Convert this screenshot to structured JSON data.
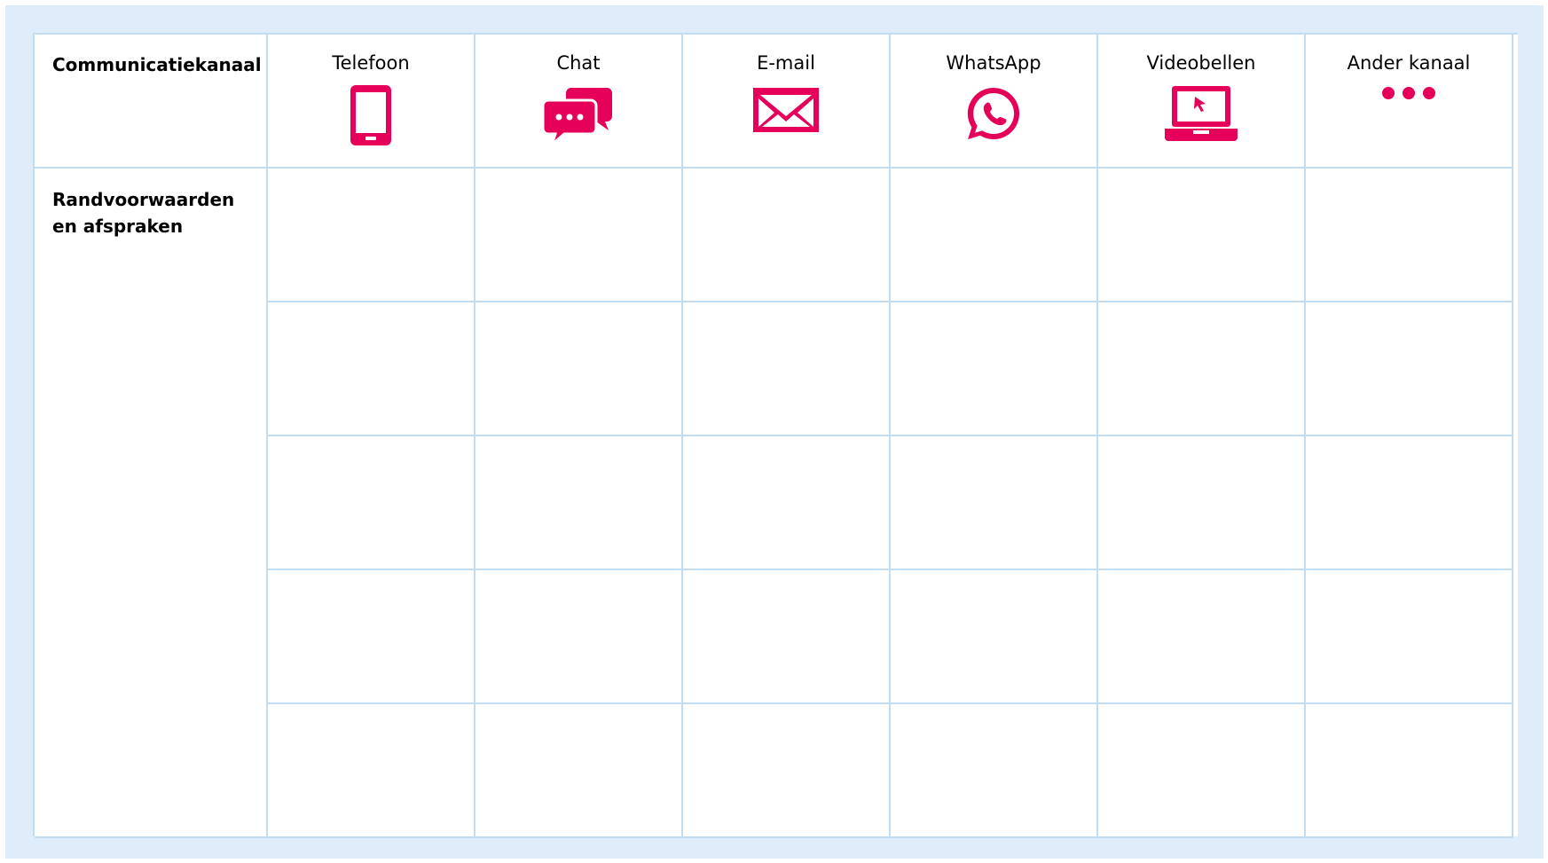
{
  "header": {
    "corner_label": "Communicatiekanaal",
    "channels": [
      {
        "label": "Telefoon",
        "icon": "phone-icon"
      },
      {
        "label": "Chat",
        "icon": "chat-icon"
      },
      {
        "label": "E-mail",
        "icon": "mail-icon"
      },
      {
        "label": "WhatsApp",
        "icon": "whatsapp-icon"
      },
      {
        "label": "Videobellen",
        "icon": "laptop-icon"
      },
      {
        "label": "Ander kanaal",
        "icon": "more-icon"
      }
    ]
  },
  "rows": {
    "label_line1": "Randvoorwaarden",
    "label_line2": "en afspraken",
    "count": 5
  },
  "colors": {
    "accent": "#e5005a",
    "border": "#c2ddf2",
    "background": "#deedf9"
  }
}
